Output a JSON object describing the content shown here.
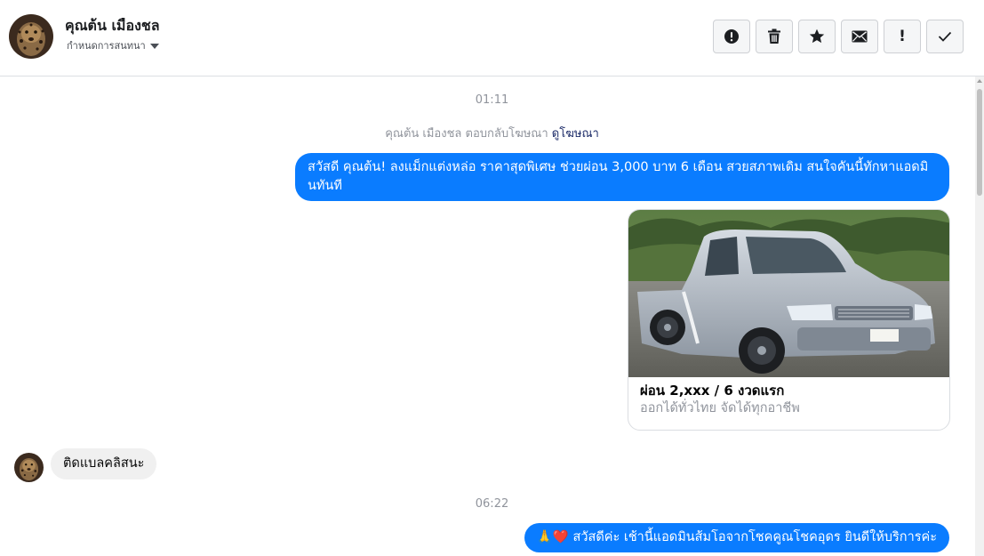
{
  "header": {
    "contact_name": "คุณต้น เมืองชล",
    "assign_label": "กำหนดการสนทนา",
    "actions": [
      {
        "name": "report-spam-button",
        "icon": "alert-circle-icon"
      },
      {
        "name": "delete-button",
        "icon": "trash-icon"
      },
      {
        "name": "star-button",
        "icon": "star-icon"
      },
      {
        "name": "mark-unread-button",
        "icon": "envelope-icon"
      },
      {
        "name": "follow-up-button",
        "icon": "exclamation-icon",
        "glyph": "!"
      },
      {
        "name": "mark-done-button",
        "icon": "check-icon"
      }
    ]
  },
  "thread": {
    "timestamp_1": "01:11",
    "ad_reply_note": "คุณต้น เมืองชล ตอบกลับโฆษณา",
    "ad_reply_link": "ดูโฆษณา",
    "outgoing_1": "สวัสดี คุณต้น! ลงแม็กแต่งหล่อ ราคาสุดพิเศษ ช่วยผ่อน 3,000 บาท 6 เดือน สวยสภาพเดิม สนใจคันนี้ทักหาแอดมินทันที",
    "ad_card": {
      "title": "ผ่อน 2,xxx / 6 งวดแรก",
      "subtitle": "ออกได้ทั่วไทย จัดได้ทุกอาชีพ",
      "image_subject": "silver pickup truck"
    },
    "incoming_1": "ติดแบลคลิสนะ",
    "timestamp_2": "06:22",
    "outgoing_2": "🙏❤️ สวัสดีค่ะ เช้านี้แอดมินส้มโอจากโชคคูณโชคอุดร ยินดีให้บริการค่ะ"
  },
  "colors": {
    "outgoing_bubble": "#0a7cff",
    "incoming_bubble": "#f0f0f0",
    "timestamp_text": "#90949c",
    "link_text": "#1c2b68"
  }
}
